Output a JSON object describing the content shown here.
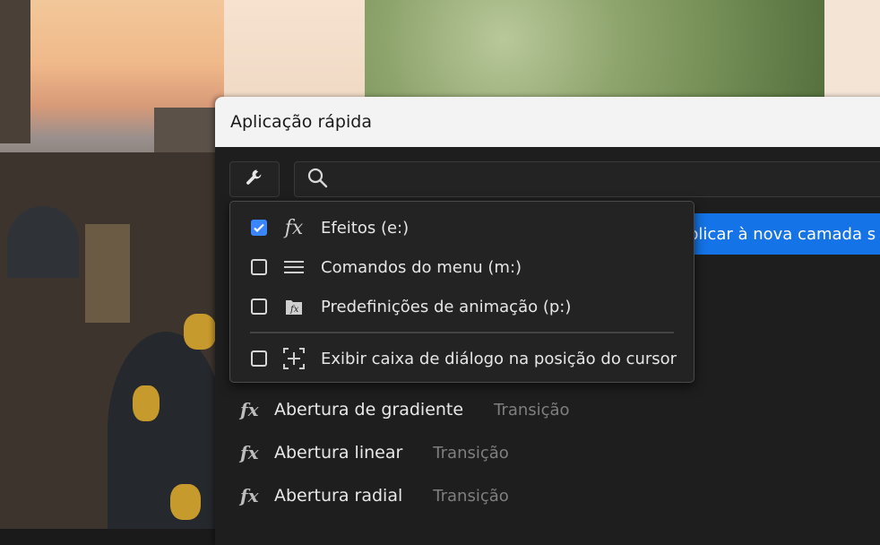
{
  "dialog": {
    "title": "Aplicação rápida",
    "search_placeholder": "",
    "highlight_text": "plicar à nova camada s"
  },
  "dropdown": {
    "items": [
      {
        "label": "Efeitos (e:)",
        "checked": true,
        "icon": "fx-icon"
      },
      {
        "label": "Comandos do menu (m:)",
        "checked": false,
        "icon": "menu-lines-icon"
      },
      {
        "label": "Predefinições de animação (p:)",
        "checked": false,
        "icon": "animation-preset-icon"
      },
      {
        "label": "Exibir caixa de diálogo na posição do cursor",
        "checked": false,
        "icon": "cursor-position-icon"
      }
    ]
  },
  "results": [
    {
      "icon": "fx",
      "name": "Abertura de gradiente",
      "category": "Transição"
    },
    {
      "icon": "fx",
      "name": "Abertura linear",
      "category": "Transição"
    },
    {
      "icon": "fx",
      "name": "Abertura radial",
      "category": "Transição"
    }
  ],
  "colors": {
    "accent": "#1473e6",
    "checkbox": "#3a86ff",
    "panel": "#1e1e1e"
  }
}
